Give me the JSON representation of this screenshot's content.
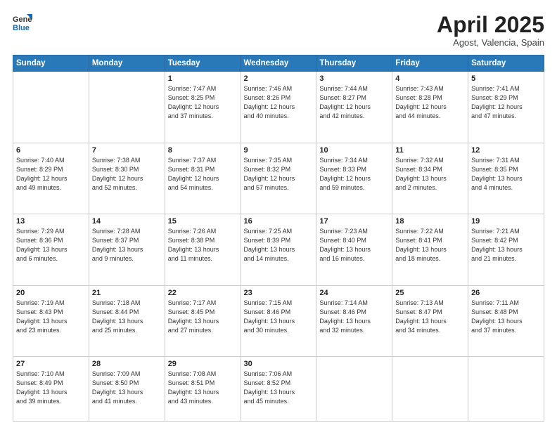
{
  "header": {
    "logo_general": "General",
    "logo_blue": "Blue",
    "month_year": "April 2025",
    "location": "Agost, Valencia, Spain"
  },
  "weekdays": [
    "Sunday",
    "Monday",
    "Tuesday",
    "Wednesday",
    "Thursday",
    "Friday",
    "Saturday"
  ],
  "weeks": [
    [
      {
        "day": null,
        "detail": null
      },
      {
        "day": null,
        "detail": null
      },
      {
        "day": "1",
        "detail": "Sunrise: 7:47 AM\nSunset: 8:25 PM\nDaylight: 12 hours\nand 37 minutes."
      },
      {
        "day": "2",
        "detail": "Sunrise: 7:46 AM\nSunset: 8:26 PM\nDaylight: 12 hours\nand 40 minutes."
      },
      {
        "day": "3",
        "detail": "Sunrise: 7:44 AM\nSunset: 8:27 PM\nDaylight: 12 hours\nand 42 minutes."
      },
      {
        "day": "4",
        "detail": "Sunrise: 7:43 AM\nSunset: 8:28 PM\nDaylight: 12 hours\nand 44 minutes."
      },
      {
        "day": "5",
        "detail": "Sunrise: 7:41 AM\nSunset: 8:29 PM\nDaylight: 12 hours\nand 47 minutes."
      }
    ],
    [
      {
        "day": "6",
        "detail": "Sunrise: 7:40 AM\nSunset: 8:29 PM\nDaylight: 12 hours\nand 49 minutes."
      },
      {
        "day": "7",
        "detail": "Sunrise: 7:38 AM\nSunset: 8:30 PM\nDaylight: 12 hours\nand 52 minutes."
      },
      {
        "day": "8",
        "detail": "Sunrise: 7:37 AM\nSunset: 8:31 PM\nDaylight: 12 hours\nand 54 minutes."
      },
      {
        "day": "9",
        "detail": "Sunrise: 7:35 AM\nSunset: 8:32 PM\nDaylight: 12 hours\nand 57 minutes."
      },
      {
        "day": "10",
        "detail": "Sunrise: 7:34 AM\nSunset: 8:33 PM\nDaylight: 12 hours\nand 59 minutes."
      },
      {
        "day": "11",
        "detail": "Sunrise: 7:32 AM\nSunset: 8:34 PM\nDaylight: 13 hours\nand 2 minutes."
      },
      {
        "day": "12",
        "detail": "Sunrise: 7:31 AM\nSunset: 8:35 PM\nDaylight: 13 hours\nand 4 minutes."
      }
    ],
    [
      {
        "day": "13",
        "detail": "Sunrise: 7:29 AM\nSunset: 8:36 PM\nDaylight: 13 hours\nand 6 minutes."
      },
      {
        "day": "14",
        "detail": "Sunrise: 7:28 AM\nSunset: 8:37 PM\nDaylight: 13 hours\nand 9 minutes."
      },
      {
        "day": "15",
        "detail": "Sunrise: 7:26 AM\nSunset: 8:38 PM\nDaylight: 13 hours\nand 11 minutes."
      },
      {
        "day": "16",
        "detail": "Sunrise: 7:25 AM\nSunset: 8:39 PM\nDaylight: 13 hours\nand 14 minutes."
      },
      {
        "day": "17",
        "detail": "Sunrise: 7:23 AM\nSunset: 8:40 PM\nDaylight: 13 hours\nand 16 minutes."
      },
      {
        "day": "18",
        "detail": "Sunrise: 7:22 AM\nSunset: 8:41 PM\nDaylight: 13 hours\nand 18 minutes."
      },
      {
        "day": "19",
        "detail": "Sunrise: 7:21 AM\nSunset: 8:42 PM\nDaylight: 13 hours\nand 21 minutes."
      }
    ],
    [
      {
        "day": "20",
        "detail": "Sunrise: 7:19 AM\nSunset: 8:43 PM\nDaylight: 13 hours\nand 23 minutes."
      },
      {
        "day": "21",
        "detail": "Sunrise: 7:18 AM\nSunset: 8:44 PM\nDaylight: 13 hours\nand 25 minutes."
      },
      {
        "day": "22",
        "detail": "Sunrise: 7:17 AM\nSunset: 8:45 PM\nDaylight: 13 hours\nand 27 minutes."
      },
      {
        "day": "23",
        "detail": "Sunrise: 7:15 AM\nSunset: 8:46 PM\nDaylight: 13 hours\nand 30 minutes."
      },
      {
        "day": "24",
        "detail": "Sunrise: 7:14 AM\nSunset: 8:46 PM\nDaylight: 13 hours\nand 32 minutes."
      },
      {
        "day": "25",
        "detail": "Sunrise: 7:13 AM\nSunset: 8:47 PM\nDaylight: 13 hours\nand 34 minutes."
      },
      {
        "day": "26",
        "detail": "Sunrise: 7:11 AM\nSunset: 8:48 PM\nDaylight: 13 hours\nand 37 minutes."
      }
    ],
    [
      {
        "day": "27",
        "detail": "Sunrise: 7:10 AM\nSunset: 8:49 PM\nDaylight: 13 hours\nand 39 minutes."
      },
      {
        "day": "28",
        "detail": "Sunrise: 7:09 AM\nSunset: 8:50 PM\nDaylight: 13 hours\nand 41 minutes."
      },
      {
        "day": "29",
        "detail": "Sunrise: 7:08 AM\nSunset: 8:51 PM\nDaylight: 13 hours\nand 43 minutes."
      },
      {
        "day": "30",
        "detail": "Sunrise: 7:06 AM\nSunset: 8:52 PM\nDaylight: 13 hours\nand 45 minutes."
      },
      {
        "day": null,
        "detail": null
      },
      {
        "day": null,
        "detail": null
      },
      {
        "day": null,
        "detail": null
      }
    ]
  ]
}
